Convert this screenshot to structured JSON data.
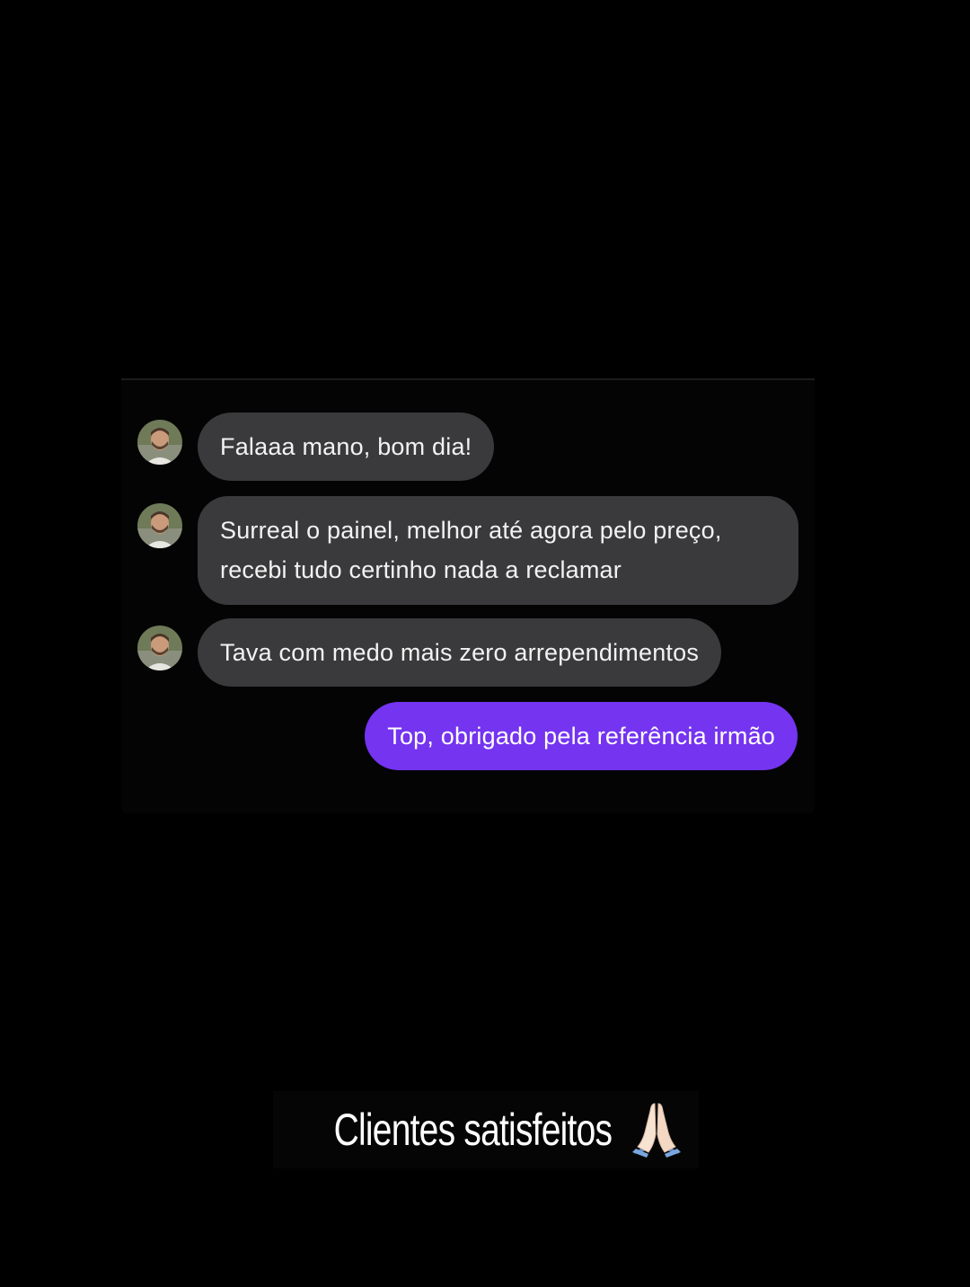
{
  "conversation": {
    "messages": [
      {
        "direction": "incoming",
        "text": "Falaaa mano, bom dia!"
      },
      {
        "direction": "incoming",
        "text_line1": "Surreal o painel, melhor até agora pelo preço,",
        "text_line2": "recebi tudo certinho nada a reclamar"
      },
      {
        "direction": "incoming",
        "text": "Tava com medo mais zero arrependimentos"
      },
      {
        "direction": "outgoing",
        "text": "Top, obrigado pela referência irmão"
      }
    ]
  },
  "caption": {
    "text": "Clientes satisfeitos",
    "icon": "folded-hands-icon"
  },
  "colors": {
    "background": "#000000",
    "incoming_bubble": "#3a3a3c",
    "outgoing_bubble": "#7434f0"
  }
}
